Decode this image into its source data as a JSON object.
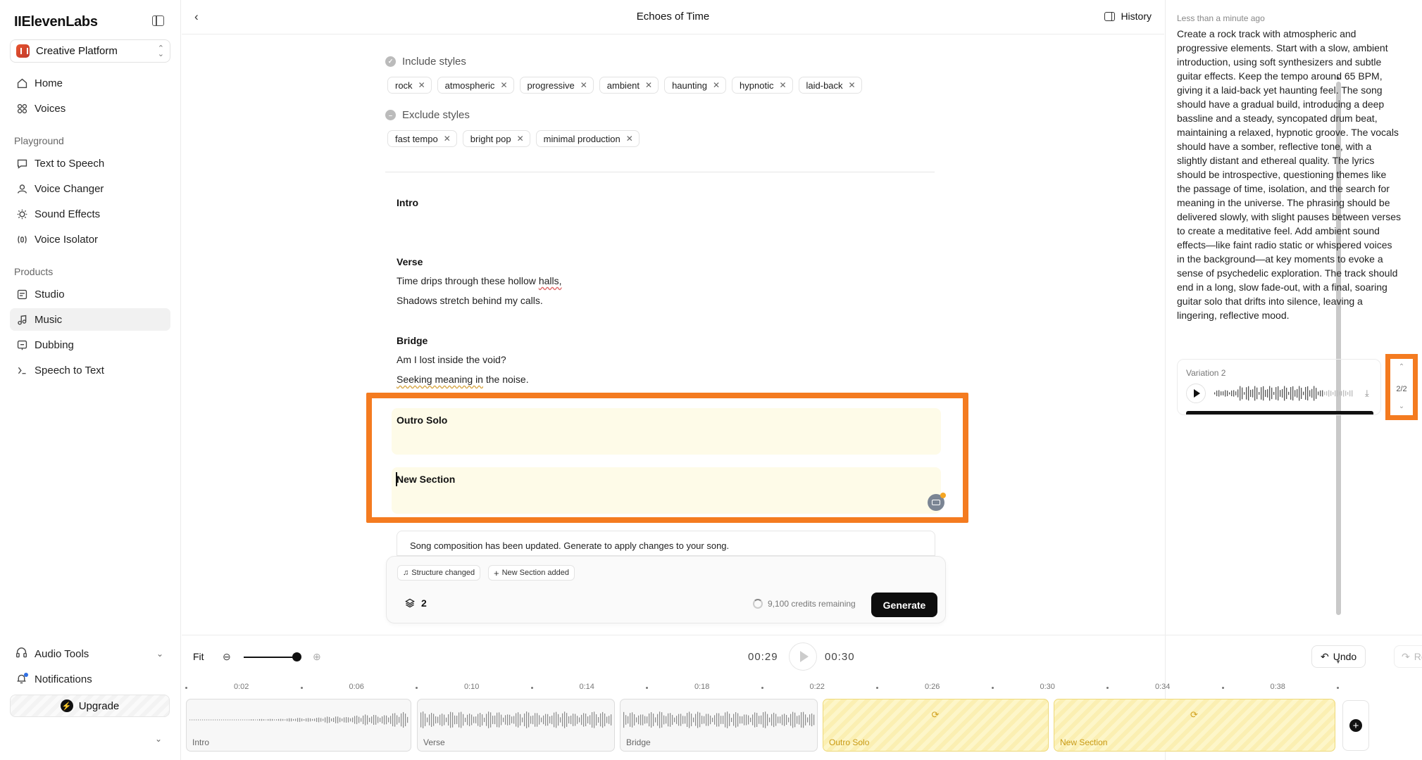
{
  "sidebar": {
    "logo": "IIElevenLabs",
    "workspace": "Creative Platform",
    "top_items": [
      {
        "label": "Home",
        "icon": "home-icon"
      },
      {
        "label": "Voices",
        "icon": "voices-icon"
      }
    ],
    "playground_label": "Playground",
    "playground_items": [
      {
        "label": "Text to Speech",
        "icon": "text-to-speech-icon"
      },
      {
        "label": "Voice Changer",
        "icon": "voice-changer-icon"
      },
      {
        "label": "Sound Effects",
        "icon": "sound-effects-icon"
      },
      {
        "label": "Voice Isolator",
        "icon": "voice-isolator-icon"
      }
    ],
    "products_label": "Products",
    "products_items": [
      {
        "label": "Studio",
        "icon": "studio-icon"
      },
      {
        "label": "Music",
        "icon": "music-icon",
        "active": true
      },
      {
        "label": "Dubbing",
        "icon": "dubbing-icon"
      },
      {
        "label": "Speech to Text",
        "icon": "speech-to-text-icon"
      }
    ],
    "audio_tools": "Audio Tools",
    "notifications": "Notifications",
    "upgrade": "Upgrade"
  },
  "header": {
    "title": "Echoes of Time",
    "history": "History"
  },
  "editor": {
    "include_label": "Include styles",
    "include_styles": [
      "rock",
      "atmospheric",
      "progressive",
      "ambient",
      "haunting",
      "hypnotic",
      "laid-back"
    ],
    "exclude_label": "Exclude styles",
    "exclude_styles": [
      "fast tempo",
      "bright pop",
      "minimal production"
    ],
    "sections": {
      "intro": "Intro",
      "verse": "Verse",
      "verse_line1_a": "Time drips through these hollow ",
      "verse_line1_b": "halls,",
      "verse_line2": "Shadows stretch behind my calls.",
      "bridge": "Bridge",
      "bridge_line1": "Am I lost inside the void?",
      "bridge_line2_a": "Seeking meaning in",
      "bridge_line2_b": " the noise.",
      "outro": "Outro Solo",
      "new_section": "New Section"
    },
    "notice": "Song composition has been updated. Generate to apply changes to your song.",
    "tag_structure": "Structure changed",
    "tag_new_section": "New Section added",
    "layers_count": "2",
    "credits": "9,100 credits remaining",
    "generate": "Generate"
  },
  "right_panel": {
    "timestamp": "Less than a minute ago",
    "prompt": "Create a rock track with atmospheric and progressive elements. Start with a slow, ambient introduction, using soft synthesizers and subtle guitar effects. Keep the tempo around 65 BPM, giving it a laid-back yet haunting feel. The song should have a gradual build, introducing a deep bassline and a steady, syncopated drum beat, maintaining a relaxed, hypnotic groove. The vocals should have a somber, reflective tone, with a slightly distant and ethereal quality. The lyrics should be introspective, questioning themes like the passage of time, isolation, and the search for meaning in the universe. The phrasing should be delivered slowly, with slight pauses between verses to create a meditative feel. Add ambient sound effects—like faint radio static or whispered voices in the background—at key moments to evoke a sense of psychedelic exploration. The track should end in a long, slow fade-out, with a final, soaring guitar solo that drifts into silence, leaving a lingering, reflective mood.",
    "variation_label": "Variation 2",
    "variation_counter": "2/2"
  },
  "transport": {
    "fit": "Fit",
    "current_time": "00:29",
    "total_time": "00:30",
    "undo": "Undo",
    "redo": "Redo",
    "zoom_level": 0.9
  },
  "timeline": {
    "ticks": [
      "0:02",
      "0:06",
      "0:10",
      "0:14",
      "0:18",
      "0:22",
      "0:26",
      "0:30",
      "0:34",
      "0:38"
    ],
    "clips": [
      {
        "name": "Intro",
        "pending": false
      },
      {
        "name": "Verse",
        "pending": false
      },
      {
        "name": "Bridge",
        "pending": false
      },
      {
        "name": "Outro Solo",
        "pending": true
      },
      {
        "name": "New Section",
        "pending": true
      }
    ]
  },
  "colors": {
    "accent_frame": "#f47b20",
    "pending_section": "#fefbe8",
    "pending_clip_text": "#c89a15",
    "button_dark": "#0d0d0d"
  }
}
